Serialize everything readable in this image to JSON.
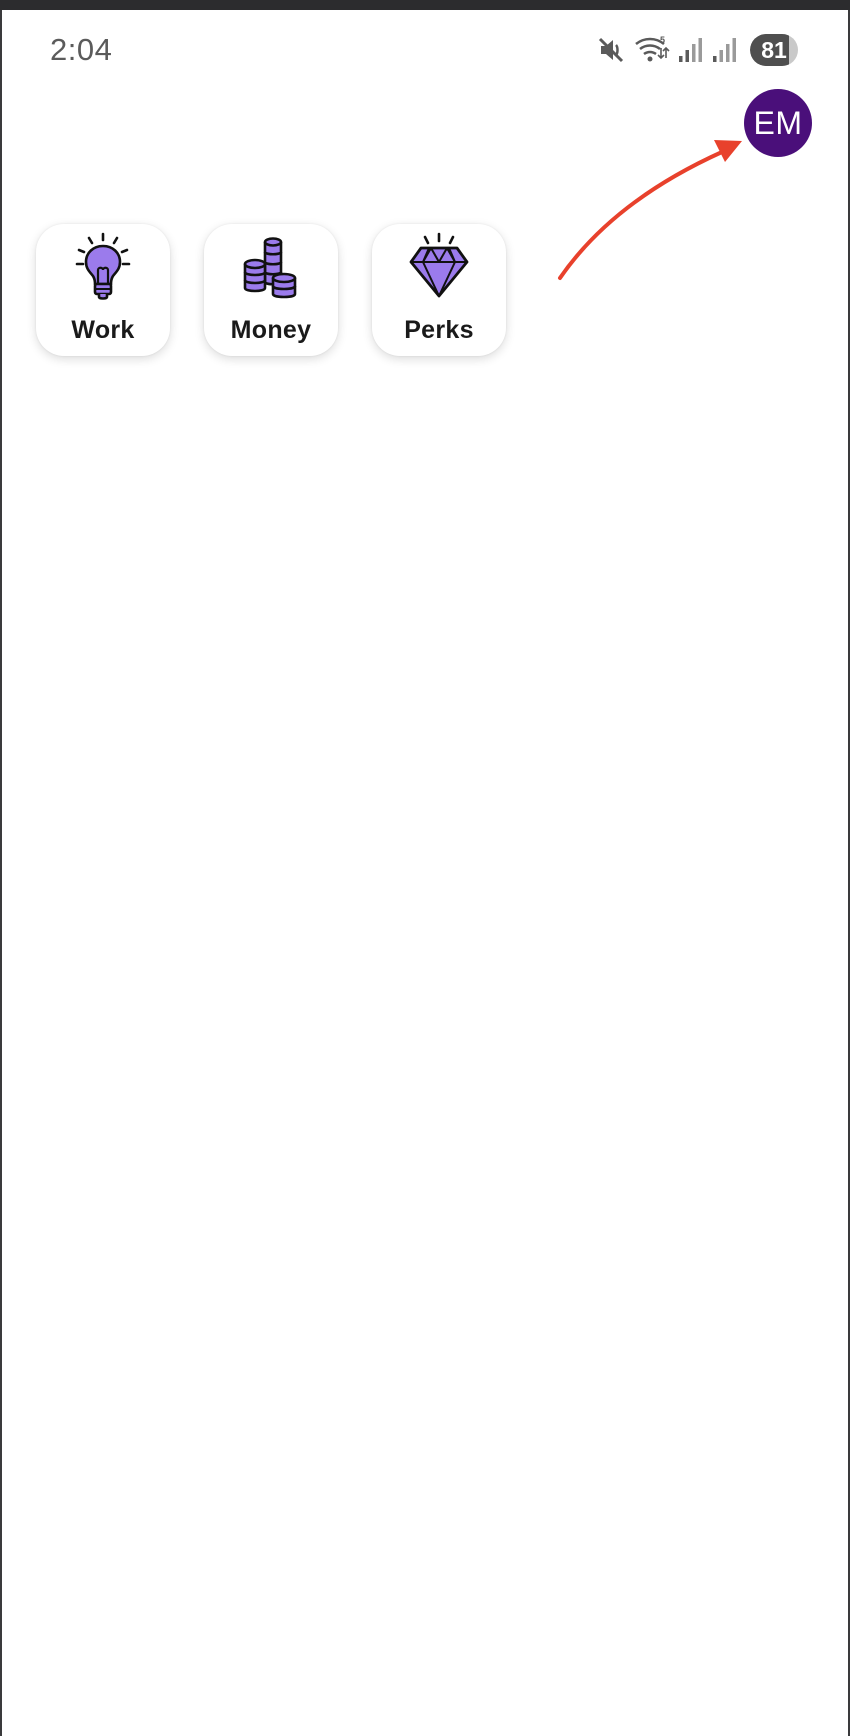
{
  "status_bar": {
    "time": "2:04",
    "battery_level": "81",
    "battery_fraction": 0.81,
    "icons": [
      "mute-icon",
      "wifi-icon",
      "signal-icon",
      "signal-icon"
    ]
  },
  "avatar": {
    "initials": "EM",
    "color": "#4a0f7a"
  },
  "annotation": {
    "arrow_color": "#e8412c"
  },
  "tiles": [
    {
      "label": "Work",
      "icon": "lightbulb-icon"
    },
    {
      "label": "Money",
      "icon": "coins-icon"
    },
    {
      "label": "Perks",
      "icon": "diamond-icon"
    }
  ],
  "colors": {
    "icon_fill": "#9b7bec",
    "icon_stroke": "#111111"
  }
}
